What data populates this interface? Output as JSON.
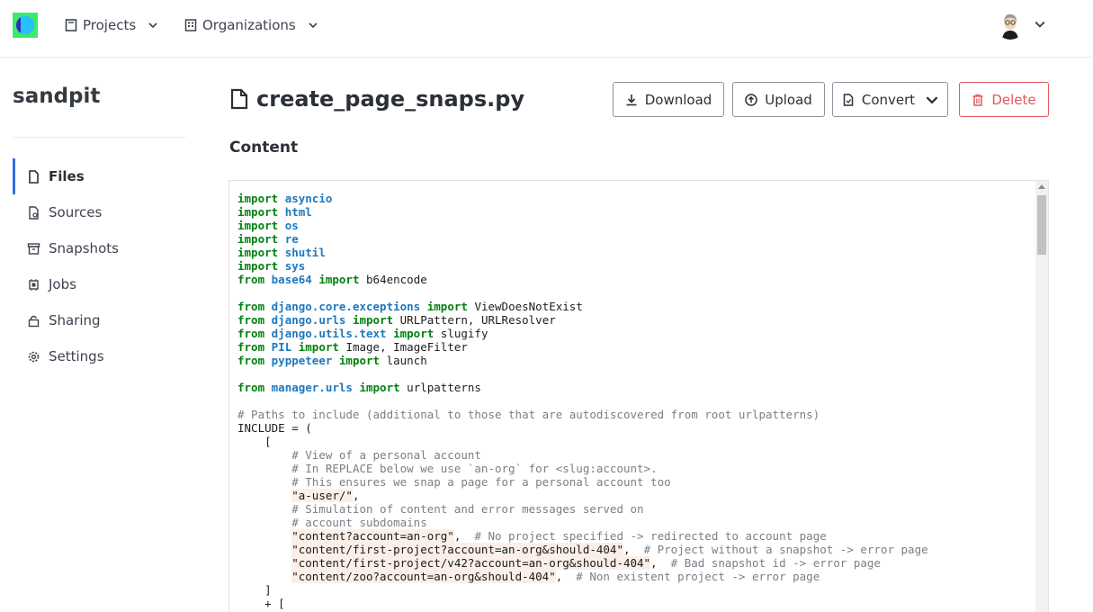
{
  "topbar": {
    "projects_label": "Projects",
    "organizations_label": "Organizations"
  },
  "sidebar": {
    "title": "sandpit",
    "items": [
      {
        "label": "Files",
        "icon": "file-icon"
      },
      {
        "label": "Sources",
        "icon": "source-icon"
      },
      {
        "label": "Snapshots",
        "icon": "archive-icon"
      },
      {
        "label": "Jobs",
        "icon": "cpu-icon"
      },
      {
        "label": "Sharing",
        "icon": "lock-icon"
      },
      {
        "label": "Settings",
        "icon": "gear-icon"
      }
    ]
  },
  "main": {
    "title": "create_page_snaps.py",
    "section": "Content",
    "buttons": {
      "download": "Download",
      "upload": "Upload",
      "convert": "Convert",
      "delete": "Delete"
    }
  },
  "colors": {
    "accent": "#2f6fdf",
    "danger": "#e0595b",
    "keyword": "#00820f",
    "module": "#1e78bf",
    "comment": "#7a7f86"
  },
  "code_lines": [
    "import asyncio",
    "import html",
    "import os",
    "import re",
    "import shutil",
    "import sys",
    "from base64 import b64encode",
    "",
    "from django.core.exceptions import ViewDoesNotExist",
    "from django.urls import URLPattern, URLResolver",
    "from django.utils.text import slugify",
    "from PIL import Image, ImageFilter",
    "from pyppeteer import launch",
    "",
    "from manager.urls import urlpatterns",
    "",
    "# Paths to include (additional to those that are autodiscovered from root urlpatterns)",
    "INCLUDE = (",
    "    [",
    "        # View of a personal account",
    "        # In REPLACE below we use `an-org` for <slug:account>.",
    "        # This ensures we snap a page for a personal account too",
    "        \"a-user/\",",
    "        # Simulation of content and error messages served on",
    "        # account subdomains",
    "        \"content?account=an-org\",  # No project specified -> redirected to account page",
    "        \"content/first-project?account=an-org&should-404\",  # Project without a snapshot -> error page",
    "        \"content/first-project/v42?account=an-org&should-404\",  # Bad snapshot id -> error page",
    "        \"content/zoo?account=an-org&should-404\",  # Non existent project -> error page",
    "    ]",
    "    + ["
  ]
}
